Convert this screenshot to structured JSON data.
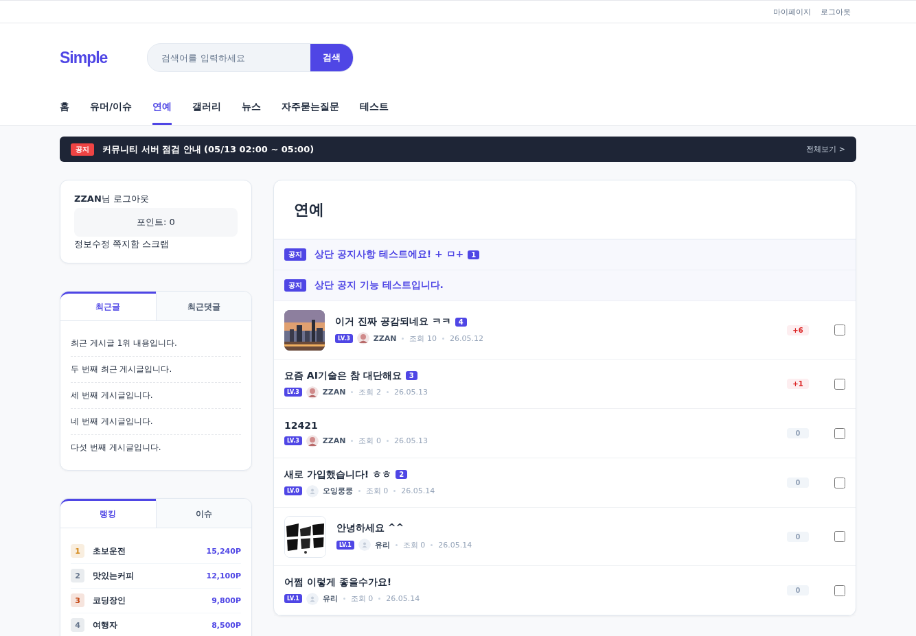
{
  "top_links": [
    "마이페이지",
    "로그아웃"
  ],
  "logo": "Simple",
  "search": {
    "placeholder": "검색어를 입력하세요",
    "button": "검색"
  },
  "nav": [
    {
      "label": "홈",
      "selected": false
    },
    {
      "label": "유머/이슈",
      "selected": false
    },
    {
      "label": "연예",
      "selected": true
    },
    {
      "label": "갤러리",
      "selected": false
    },
    {
      "label": "뉴스",
      "selected": false
    },
    {
      "label": "자주묻는질문",
      "selected": false
    },
    {
      "label": "테스트",
      "selected": false
    }
  ],
  "notice_bar": {
    "badge": "공지",
    "text": "커뮤니티 서버 점검 안내 (05/13 02:00 ~ 05:00)",
    "link": "전체보기 >"
  },
  "user_box": {
    "name": "ZZAN",
    "suffix": "님",
    "logout": "로그아웃",
    "points": "포인트: 0",
    "links": [
      "정보수정",
      "쪽지함",
      "스크랩"
    ]
  },
  "recent": {
    "tabs": [
      {
        "label": "최근글",
        "selected": true
      },
      {
        "label": "최근댓글",
        "selected": false
      }
    ],
    "items": [
      "최근 게시글 1위 내용입니다.",
      "두 번째 최근 게시글입니다.",
      "세 번째 게시글입니다.",
      "네 번째 게시글입니다.",
      "다섯 번째 게시글입니다."
    ]
  },
  "ranking": {
    "tabs": [
      {
        "label": "랭킹",
        "selected": true
      },
      {
        "label": "이슈",
        "selected": false
      }
    ],
    "items": [
      {
        "rank": "1",
        "name": "초보운전",
        "points": "15,240P",
        "color": "#d4891a"
      },
      {
        "rank": "2",
        "name": "맛있는커피",
        "points": "12,100P",
        "color": "#64748b"
      },
      {
        "rank": "3",
        "name": "코딩장인",
        "points": "9,800P",
        "color": "#c2410c"
      },
      {
        "rank": "4",
        "name": "여행자",
        "points": "8,500P",
        "color": "#64748b"
      }
    ]
  },
  "board": {
    "title": "연예",
    "notices": [
      {
        "badge": "공지",
        "title": "상단 공지사항 테스트에요! + ㅁ+",
        "comments": "1"
      },
      {
        "badge": "공지",
        "title": "상단 공지 기능 테스트입니다."
      }
    ],
    "posts": [
      {
        "kind": "picture",
        "title": "이거 진짜 공감되네요 ㅋㅋ",
        "comments": "4",
        "level": "LV.3",
        "author": "ZZAN",
        "views": "조회 10",
        "date": "26.05.12",
        "votes": "+6",
        "positive": true,
        "checked": false
      },
      {
        "kind": "text",
        "title": "요즘 AI기술은 참 대단해요",
        "comments": "3",
        "level": "LV.3",
        "author": "ZZAN",
        "views": "조회 2",
        "date": "26.05.13",
        "votes": "+1",
        "positive": true,
        "checked": false
      },
      {
        "kind": "text",
        "title": "12421",
        "level": "LV.3",
        "author": "ZZAN",
        "views": "조회 0",
        "date": "26.05.13",
        "votes": "0",
        "positive": false,
        "checked": false
      },
      {
        "kind": "text",
        "title": "새로 가입했습니다! ㅎㅎ",
        "comments": "2",
        "level": "LV.0",
        "avatar": {
          "kind": "default"
        },
        "author": "오잉쿵쿵",
        "views": "조회 0",
        "date": "26.05.14",
        "votes": "0",
        "positive": false,
        "checked": false
      },
      {
        "kind": "picture",
        "title": "안녕하세요 ^^",
        "level": "LV.1",
        "avatar": {
          "kind": "default"
        },
        "author": "유리",
        "views": "조회 0",
        "date": "26.05.14",
        "votes": "0",
        "positive": false,
        "checked": false
      },
      {
        "kind": "text",
        "title": "어쩜 이렇게 좋을수가요!",
        "level": "LV.1",
        "avatar": {
          "kind": "default"
        },
        "author": "유리",
        "views": "조회 0",
        "date": "26.05.14",
        "votes": "0",
        "positive": false,
        "checked": false
      }
    ]
  }
}
